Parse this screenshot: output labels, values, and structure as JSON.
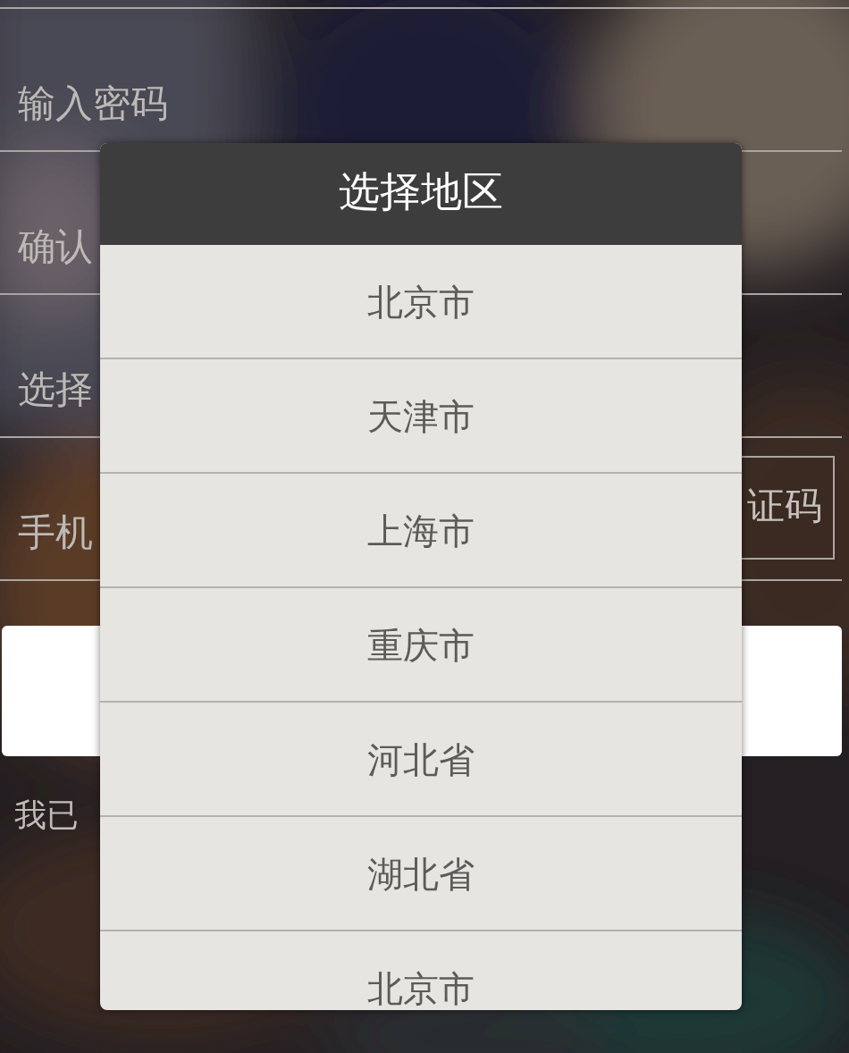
{
  "form": {
    "fields": [
      {
        "placeholder": "输入密码"
      },
      {
        "placeholder": "确认"
      },
      {
        "placeholder": "选择"
      },
      {
        "placeholder": "手机"
      }
    ],
    "code_button": "证码",
    "agreement": "我已"
  },
  "dialog": {
    "title": "选择地区",
    "items": [
      "北京市",
      "天津市",
      "上海市",
      "重庆市",
      "河北省",
      "湖北省",
      "北京市"
    ]
  }
}
